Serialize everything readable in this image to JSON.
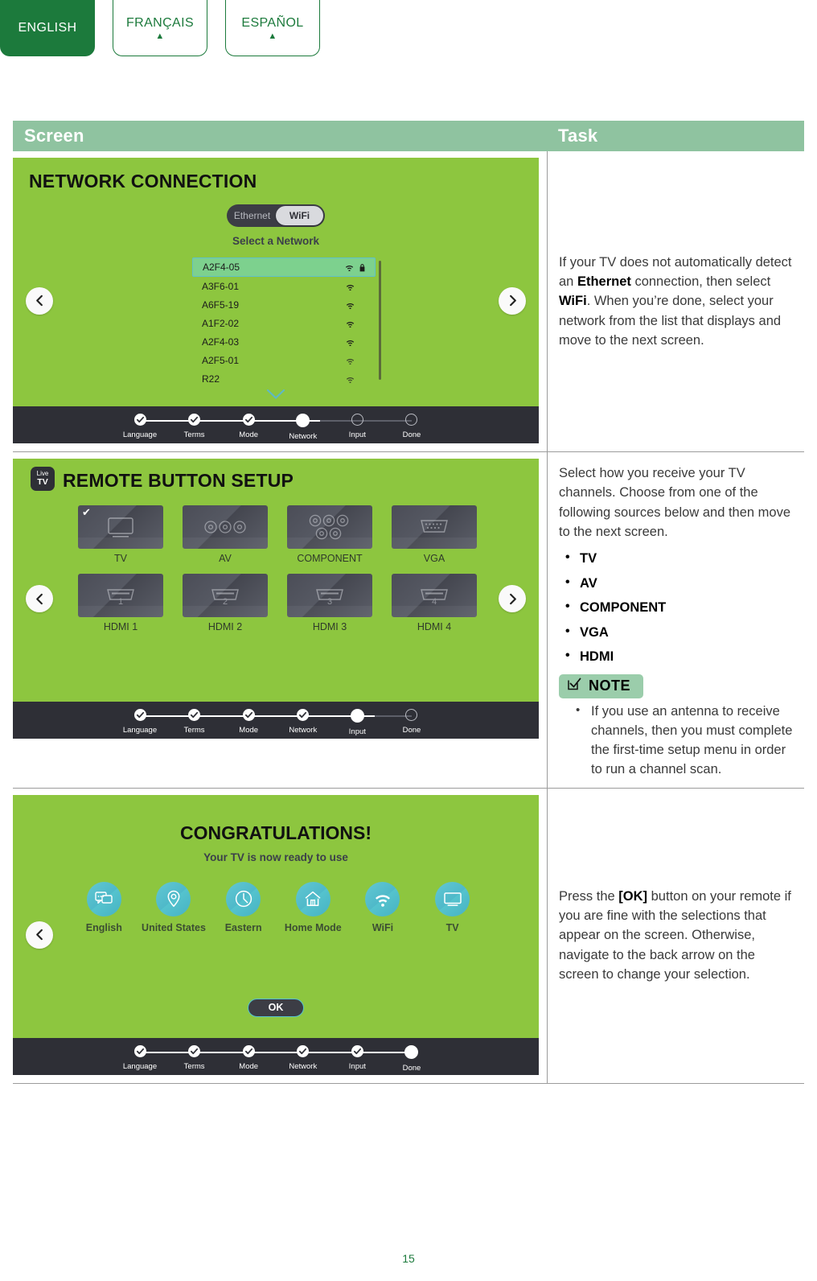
{
  "language_tabs": [
    {
      "label": "ENGLISH",
      "active": true
    },
    {
      "label": "FRANÇAIS",
      "active": false
    },
    {
      "label": "ESPAÑOL",
      "active": false
    }
  ],
  "table_header": {
    "screen": "Screen",
    "task": "Task"
  },
  "rows": [
    {
      "screen": {
        "title": "NETWORK CONNECTION",
        "toggle": {
          "options": [
            "Ethernet",
            "WiFi"
          ],
          "selected": "WiFi"
        },
        "list_label": "Select a Network",
        "networks": [
          {
            "ssid": "A2F4-05",
            "selected": true,
            "locked": true
          },
          {
            "ssid": "A3F6-01",
            "selected": false,
            "locked": false
          },
          {
            "ssid": "A6F5-19",
            "selected": false,
            "locked": false
          },
          {
            "ssid": "A1F2-02",
            "selected": false,
            "locked": false
          },
          {
            "ssid": "A2F4-03",
            "selected": false,
            "locked": false
          },
          {
            "ssid": "A2F5-01",
            "selected": false,
            "locked": false
          },
          {
            "ssid": "R22",
            "selected": false,
            "locked": false
          }
        ],
        "progress": {
          "steps": [
            "Language",
            "Terms",
            "Mode",
            "Network",
            "Input",
            "Done"
          ],
          "current": "Network",
          "completed": [
            "Language",
            "Terms",
            "Mode"
          ]
        }
      },
      "task": {
        "paragraph_html": "If your TV does not automatically detect an <b>Ethernet</b> connection, then select <b>WiFi</b>. When you&rsquo;re done, select your network from the list that displays and move to the next screen."
      }
    },
    {
      "screen": {
        "badge": {
          "line1": "Live",
          "line2": "TV"
        },
        "title": "REMOTE BUTTON SETUP",
        "tiles": [
          {
            "label": "TV",
            "icon": "tv-icon",
            "checked": true
          },
          {
            "label": "AV",
            "icon": "av-jacks-icon",
            "checked": false
          },
          {
            "label": "COMPONENT",
            "icon": "component-jacks-icon",
            "checked": false
          },
          {
            "label": "VGA",
            "icon": "vga-connector-icon",
            "checked": false
          },
          {
            "label": "HDMI 1",
            "icon": "hdmi-port-icon",
            "checked": false
          },
          {
            "label": "HDMI 2",
            "icon": "hdmi-port-icon",
            "checked": false
          },
          {
            "label": "HDMI 3",
            "icon": "hdmi-port-icon",
            "checked": false
          },
          {
            "label": "HDMI 4",
            "icon": "hdmi-port-icon",
            "checked": false
          }
        ],
        "progress": {
          "steps": [
            "Language",
            "Terms",
            "Mode",
            "Network",
            "Input",
            "Done"
          ],
          "current": "Input",
          "completed": [
            "Language",
            "Terms",
            "Mode",
            "Network"
          ]
        }
      },
      "task": {
        "paragraph_html": "Select how you receive your TV channels. Choose from one of the following sources below and then move to the next screen.",
        "bullets": [
          "TV",
          "AV",
          "COMPONENT",
          "VGA",
          "HDMI"
        ],
        "note_label": "NOTE",
        "note_bullets": [
          "If you use an antenna to receive channels, then you must complete the first-time setup menu in order to run a channel scan."
        ]
      }
    },
    {
      "screen": {
        "title": "CONGRATULATIONS!",
        "subtitle": "Your TV is now ready to use",
        "summary": [
          {
            "label": "English",
            "icon": "chat-bubbles-icon"
          },
          {
            "label": "United States",
            "icon": "location-pin-icon"
          },
          {
            "label": "Eastern",
            "icon": "clock-icon"
          },
          {
            "label": "Home Mode",
            "icon": "home-icon"
          },
          {
            "label": "WiFi",
            "icon": "wifi-icon"
          },
          {
            "label": "TV",
            "icon": "tv-icon"
          }
        ],
        "ok_button": "OK",
        "progress": {
          "steps": [
            "Language",
            "Terms",
            "Mode",
            "Network",
            "Input",
            "Done"
          ],
          "current": "Done",
          "completed": [
            "Language",
            "Terms",
            "Mode",
            "Network",
            "Input"
          ]
        }
      },
      "task": {
        "paragraph_html": "Press the <b>[OK]</b> button on your remote if you are fine with the selections that appear on the screen. Otherwise, navigate to the back arrow on the screen to change your selection."
      }
    }
  ],
  "page_number": "15",
  "colors": {
    "brand_green": "#1c7a3c",
    "screen_green": "#8dc63f",
    "header_green": "#8fc3a0",
    "note_green": "#9bcdab",
    "teal": "#4fb9c9",
    "dark": "#2e2f36"
  }
}
